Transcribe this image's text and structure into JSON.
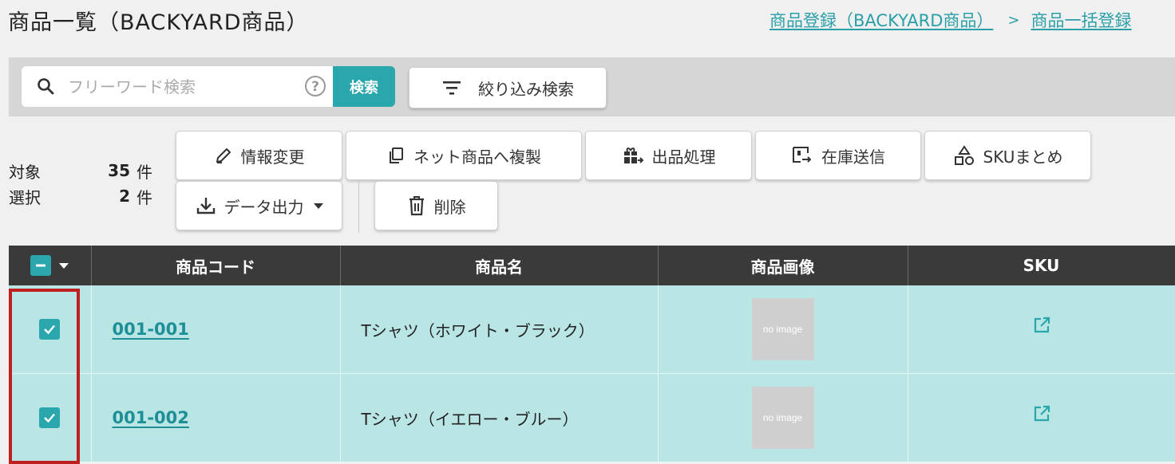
{
  "page": {
    "title": "商品一覧（BACKYARD商品）"
  },
  "breadcrumb": {
    "link1": "商品登録（BACKYARD商品）",
    "separator": ">",
    "link2": "商品一括登録"
  },
  "search": {
    "placeholder": "フリーワード検索",
    "button_label": "検索",
    "filter_label": "絞り込み検索",
    "icons": [
      "search-icon",
      "help-icon",
      "filter-icon"
    ]
  },
  "counts": {
    "target_label": "対象",
    "target_value": "35",
    "selected_label": "選択",
    "selected_value": "2",
    "unit": "件"
  },
  "actions": {
    "edit_info": "情報変更",
    "copy_to_net": "ネット商品へ複製",
    "listing": "出品処理",
    "send_stock": "在庫送信",
    "sku_group": "SKUまとめ",
    "export": "データ出力",
    "delete": "削除"
  },
  "table": {
    "headers": [
      "商品コード",
      "商品名",
      "商品画像",
      "SKU"
    ],
    "rows": [
      {
        "code": "001-001",
        "name": "Tシャツ（ホワイト・ブラック）",
        "image": "no image",
        "checked": true
      },
      {
        "code": "001-002",
        "name": "Tシャツ（イエロー・ブルー）",
        "image": "no image",
        "checked": true
      }
    ]
  },
  "colors": {
    "accent": "#2aa6ad",
    "header_bg": "#3a3a3a",
    "row_selected": "#b9e6e5",
    "highlight": "#c01f1f"
  }
}
